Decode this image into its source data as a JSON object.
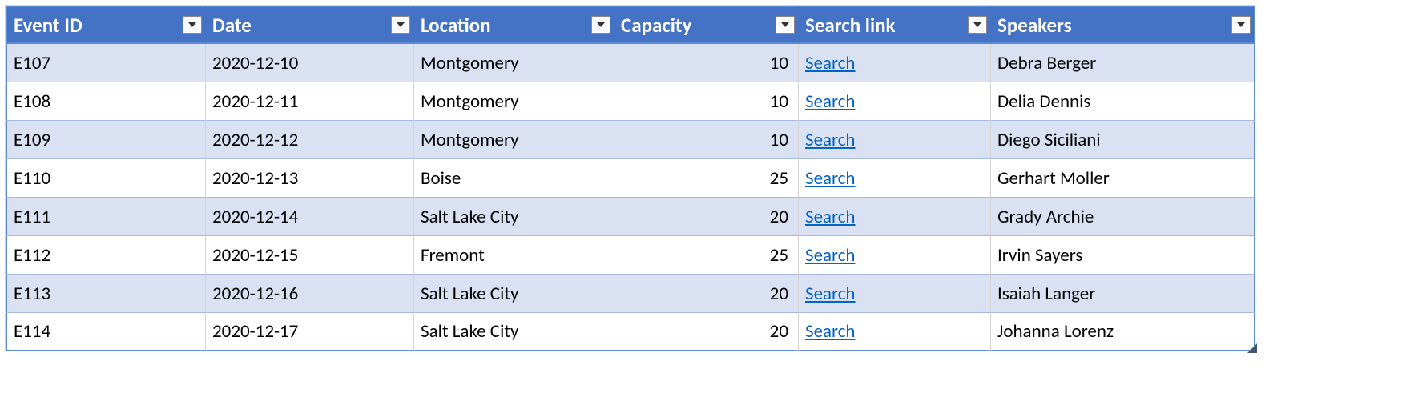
{
  "table": {
    "headers": [
      {
        "key": "event_id",
        "label": "Event ID"
      },
      {
        "key": "date",
        "label": "Date"
      },
      {
        "key": "location",
        "label": "Location"
      },
      {
        "key": "capacity",
        "label": "Capacity"
      },
      {
        "key": "search_link",
        "label": "Search link"
      },
      {
        "key": "speakers",
        "label": "Speakers"
      }
    ],
    "search_link_text": "Search",
    "rows": [
      {
        "event_id": "E107",
        "date": "2020-12-10",
        "location": "Montgomery",
        "capacity": 10,
        "speakers": "Debra Berger"
      },
      {
        "event_id": "E108",
        "date": "2020-12-11",
        "location": "Montgomery",
        "capacity": 10,
        "speakers": "Delia Dennis"
      },
      {
        "event_id": "E109",
        "date": "2020-12-12",
        "location": "Montgomery",
        "capacity": 10,
        "speakers": "Diego Siciliani"
      },
      {
        "event_id": "E110",
        "date": "2020-12-13",
        "location": "Boise",
        "capacity": 25,
        "speakers": "Gerhart Moller"
      },
      {
        "event_id": "E111",
        "date": "2020-12-14",
        "location": "Salt Lake City",
        "capacity": 20,
        "speakers": "Grady Archie"
      },
      {
        "event_id": "E112",
        "date": "2020-12-15",
        "location": "Fremont",
        "capacity": 25,
        "speakers": "Irvin Sayers"
      },
      {
        "event_id": "E113",
        "date": "2020-12-16",
        "location": "Salt Lake City",
        "capacity": 20,
        "speakers": "Isaiah Langer"
      },
      {
        "event_id": "E114",
        "date": "2020-12-17",
        "location": "Salt Lake City",
        "capacity": 20,
        "speakers": "Johanna Lorenz"
      }
    ]
  },
  "colors": {
    "header_bg": "#4472c4",
    "band_bg": "#d9e1f2",
    "border": "#5b8bd5",
    "link": "#0563c1"
  }
}
